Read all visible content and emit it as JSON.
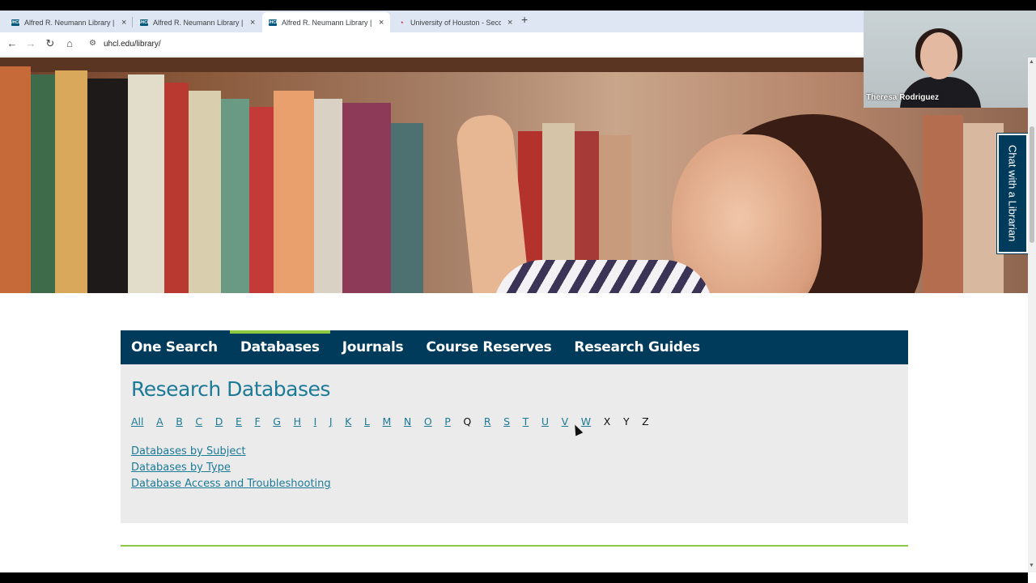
{
  "browser": {
    "tabs": [
      {
        "title": "Alfred R. Neumann Library | Uni",
        "favicon": "UHCL",
        "active": false
      },
      {
        "title": "Alfred R. Neumann Library | Uni",
        "favicon": "UHCL",
        "active": false
      },
      {
        "title": "Alfred R. Neumann Library | Uni",
        "favicon": "UHCL",
        "active": true
      },
      {
        "title": "University of Houston - Second",
        "favicon": "uh-logo",
        "active": false
      }
    ],
    "url": "uhcl.edu/library/",
    "new_tab": "+",
    "close_glyph": "×"
  },
  "webcam": {
    "name": "Theresa Rodriguez"
  },
  "chat": {
    "label": "Chat with a Librarian"
  },
  "nav": {
    "items": [
      "One Search",
      "Databases",
      "Journals",
      "Course Reserves",
      "Research Guides"
    ],
    "active": "Databases"
  },
  "panel": {
    "title": "Research Databases",
    "alphabet": [
      {
        "l": "All",
        "link": true
      },
      {
        "l": "A",
        "link": true
      },
      {
        "l": "B",
        "link": true
      },
      {
        "l": "C",
        "link": true
      },
      {
        "l": "D",
        "link": true
      },
      {
        "l": "E",
        "link": true
      },
      {
        "l": "F",
        "link": true
      },
      {
        "l": "G",
        "link": true
      },
      {
        "l": "H",
        "link": true
      },
      {
        "l": "I",
        "link": true
      },
      {
        "l": "J",
        "link": true
      },
      {
        "l": "K",
        "link": true
      },
      {
        "l": "L",
        "link": true
      },
      {
        "l": "M",
        "link": true
      },
      {
        "l": "N",
        "link": true
      },
      {
        "l": "O",
        "link": true
      },
      {
        "l": "P",
        "link": true
      },
      {
        "l": "Q",
        "link": false
      },
      {
        "l": "R",
        "link": true
      },
      {
        "l": "S",
        "link": true
      },
      {
        "l": "T",
        "link": true
      },
      {
        "l": "U",
        "link": true
      },
      {
        "l": "V",
        "link": true
      },
      {
        "l": "W",
        "link": true
      },
      {
        "l": "X",
        "link": false
      },
      {
        "l": "Y",
        "link": false
      },
      {
        "l": "Z",
        "link": false
      }
    ],
    "links": [
      "Databases by Subject",
      "Databases by Type",
      "Database Access and Troubleshooting"
    ]
  },
  "colors": {
    "navy": "#003b5c",
    "accent_green": "#8dc63f",
    "link_teal": "#1d7a96"
  }
}
